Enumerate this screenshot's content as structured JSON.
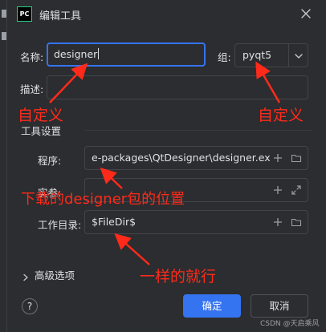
{
  "dialog": {
    "title": "编辑工具",
    "logo_text": "PC",
    "close_icon": "close-icon"
  },
  "form": {
    "name_label": "名称:",
    "name_value": "designer",
    "group_label": "组:",
    "group_value": "pyqt5",
    "desc_label": "描述:",
    "desc_value": ""
  },
  "tool_settings": {
    "section_title": "工具设置",
    "program_label": "程序:",
    "program_value": "e-packages\\QtDesigner\\designer.exe",
    "args_label": "实参:",
    "args_value": "",
    "workdir_label": "工作目录:",
    "workdir_value": "$FileDir$"
  },
  "advanced": {
    "label": "高级选项"
  },
  "footer": {
    "help_label": "?",
    "ok_label": "确定",
    "cancel_label": "取消"
  },
  "annotations": {
    "name_note": "自定义",
    "group_note": "自定义",
    "program_note": "下载的designer包的位置",
    "workdir_note": "一样的就行"
  },
  "watermark": "CSDN @天启乘风",
  "colors": {
    "background": "#2b2d30",
    "accent": "#3574f0",
    "annotation": "#ff2a1a"
  }
}
